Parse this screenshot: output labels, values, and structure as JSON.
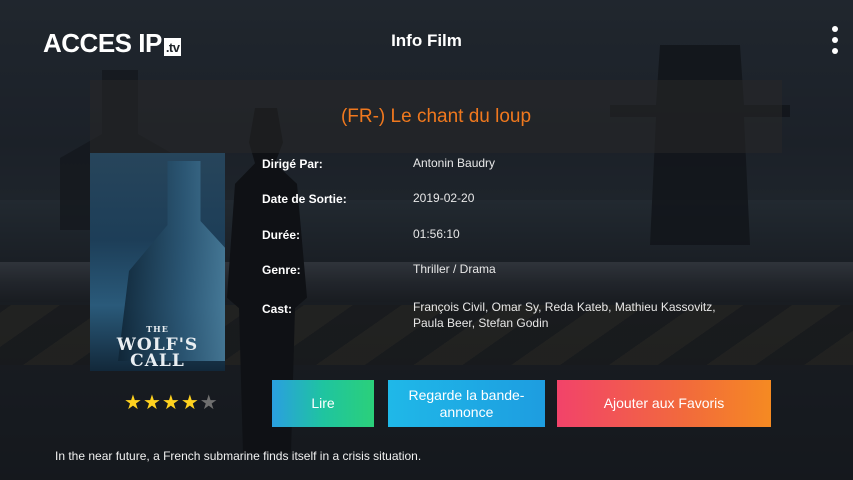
{
  "app": {
    "logo_text": "ACCES IP",
    "logo_badge": ".tv",
    "page_title": "Info Film"
  },
  "movie": {
    "title": "(FR-) Le chant du loup",
    "poster_text_small": "THE",
    "poster_text_big": "WOLF'S CALL",
    "details": [
      {
        "label": "Dirigé Par:",
        "value": "Antonin Baudry"
      },
      {
        "label": "Date de Sortie:",
        "value": "2019-02-20"
      },
      {
        "label": "Durée:",
        "value": "01:56:10"
      },
      {
        "label": "Genre:",
        "value": "Thriller / Drama"
      },
      {
        "label": "Cast:",
        "value": "François Civil, Omar Sy, Reda Kateb, Mathieu Kassovitz, Paula Beer, Stefan Godin"
      }
    ],
    "rating": {
      "stars_filled": 4,
      "stars_total": 5
    },
    "synopsis": "In the near future, a French submarine finds itself in a crisis situation."
  },
  "actions": {
    "play_label": "Lire",
    "trailer_label": "Regarde la bande-annonce",
    "favorites_label": "Ajouter aux Favoris"
  },
  "colors": {
    "title_accent": "#f0781e",
    "star_on": "#ffd21f",
    "star_off": "#6f6f6f",
    "play_gradient": [
      "#2a9fe0",
      "#2bd07a"
    ],
    "trailer_gradient": [
      "#1fb8e8",
      "#1e9de0"
    ],
    "favorites_gradient": [
      "#f2436a",
      "#f58a22"
    ]
  },
  "icons": {
    "menu": "more-vertical-icon",
    "star": "star-icon"
  }
}
